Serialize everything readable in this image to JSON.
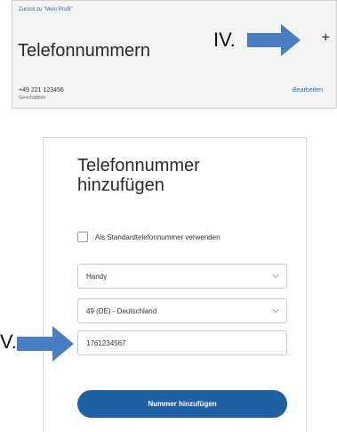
{
  "profile_panel": {
    "back_link": "Zurück zu \"Mein Profil\"",
    "title": "Telefonnummern",
    "phone": {
      "number": "+49 221 123456",
      "type": "Geschäftlich",
      "edit_label": "Bearbeiten"
    },
    "add_button": "+"
  },
  "annotations": {
    "step_iv": "IV.",
    "step_v": "V.",
    "arrow_color": "#4a7ec2"
  },
  "add_form": {
    "title": "Telefonnummer hinzufügen",
    "default_checkbox_label": "Als Standardtelefonnummer verwenden",
    "default_checked": false,
    "type_select": "Handy",
    "country_select": "49 (DE) - Deutschland",
    "number_input": "1761234567",
    "submit_label": "Nummer hinzufügen"
  },
  "colors": {
    "link": "#2a6fb5",
    "primary_button": "#1f5fa3"
  }
}
